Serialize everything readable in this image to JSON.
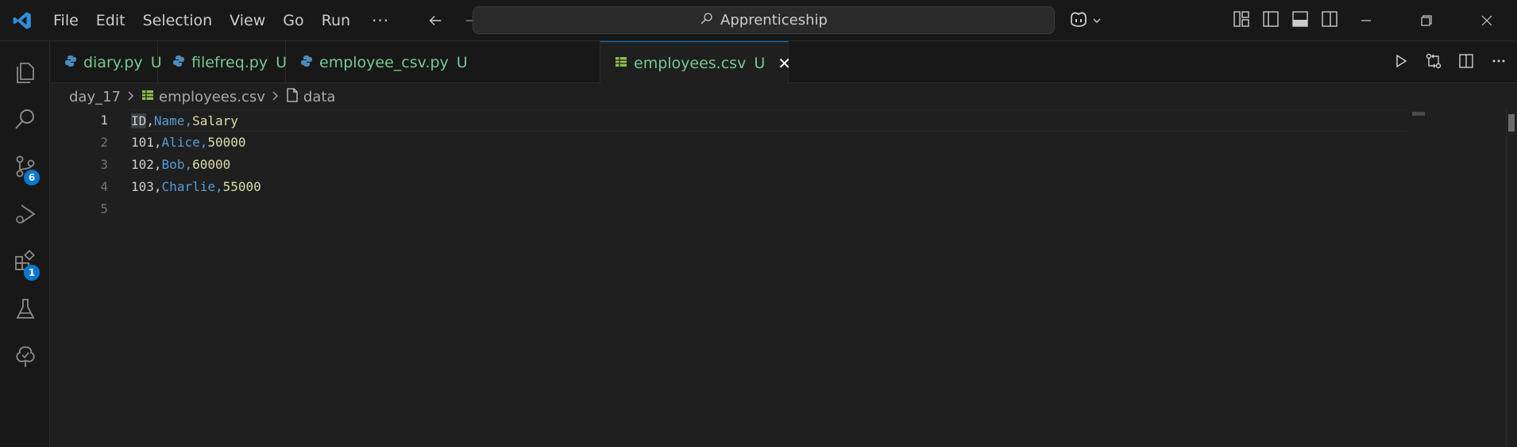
{
  "titlebar": {
    "menu": [
      "File",
      "Edit",
      "Selection",
      "View",
      "Go",
      "Run"
    ],
    "more": "···",
    "search_text": "Apprenticeship"
  },
  "activity": {
    "scm_badge": "6",
    "extensions_badge": "1"
  },
  "tabs": [
    {
      "label": "diary.py",
      "status": "U",
      "icon": "python-icon"
    },
    {
      "label": "filefreq.py",
      "status": "U",
      "icon": "python-icon"
    },
    {
      "label": "employee_csv.py",
      "status": "U",
      "icon": "python-icon"
    },
    {
      "label": "employees.csv",
      "status": "U",
      "icon": "csv-table-icon",
      "active": true
    }
  ],
  "tab_close": "✕",
  "breadcrumb": {
    "folder": "day_17",
    "file": "employees.csv",
    "symbol": "data"
  },
  "editor": {
    "line_numbers": [
      "1",
      "2",
      "3",
      "4",
      "5"
    ],
    "lines": [
      [
        "ID",
        ",",
        "Name",
        ",",
        "Salary"
      ],
      [
        "101",
        ",",
        "Alice",
        ",",
        "50000"
      ],
      [
        "102",
        ",",
        "Bob",
        ",",
        "60000"
      ],
      [
        "103",
        ",",
        "Charlie",
        ",",
        "55000"
      ],
      []
    ]
  },
  "colors": {
    "accent": "#0078d4",
    "untracked": "#73c991",
    "col1": "#cccccc",
    "col2": "#569cd6",
    "col3": "#dcdcaa"
  }
}
